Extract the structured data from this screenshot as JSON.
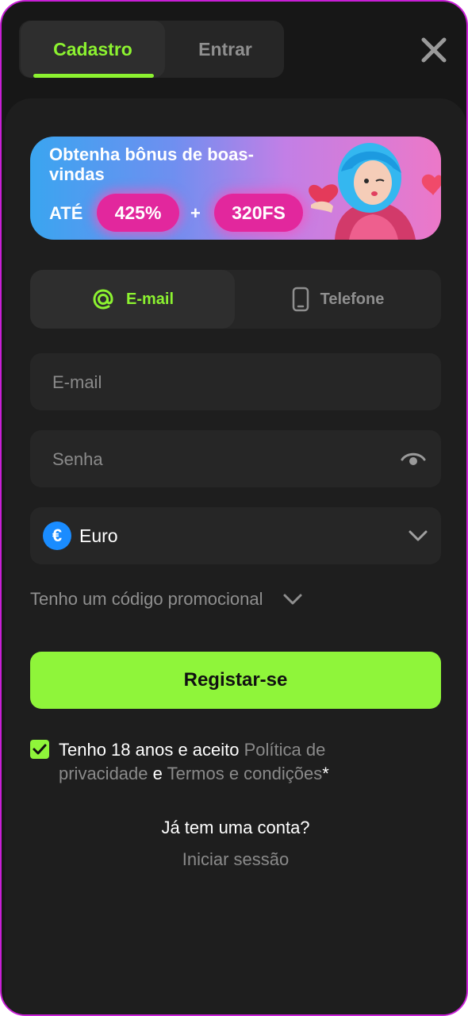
{
  "tabs": {
    "signup": "Cadastro",
    "login": "Entrar"
  },
  "banner": {
    "title": "Obtenha bônus de boas-vindas",
    "upto": "ATÉ",
    "bonus_percent": "425%",
    "plus": "+",
    "free_spins": "320FS"
  },
  "method": {
    "email": "E-mail",
    "phone": "Telefone"
  },
  "form": {
    "email_placeholder": "E-mail",
    "password_placeholder": "Senha",
    "currency": "Euro",
    "currency_symbol": "€",
    "promo": "Tenho um código promocional"
  },
  "register_label": "Registar-se",
  "terms": {
    "prefix": "Tenho 18 anos e aceito ",
    "privacy": "Política de privacidade",
    "and": " e ",
    "conditions": "Termos e condições",
    "asterisk": "*"
  },
  "footer": {
    "question": "Já tem uma conta?",
    "login": "Iniciar sessão"
  },
  "colors": {
    "accent": "#8cf230",
    "background": "#171717",
    "border": "#c81fd6",
    "pill": "#e2279d",
    "euro": "#1a8cff"
  },
  "icons": [
    "close-icon",
    "hero-character-image",
    "heart-icon",
    "at-sign-icon",
    "phone-icon",
    "eye-icon",
    "euro-icon",
    "chevron-down-icon",
    "checkmark-icon"
  ]
}
